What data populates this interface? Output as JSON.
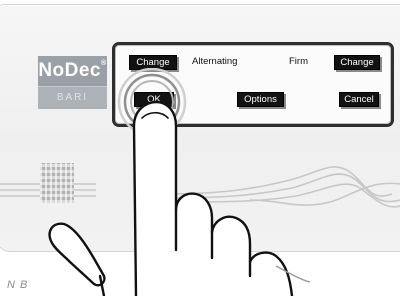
{
  "device": {
    "brand_name": "NoDec",
    "brand_trademark": "®",
    "model_name": "BARI"
  },
  "screen": {
    "change_left_label": "Change",
    "mode_left_label": "Alternating",
    "mode_right_label": "Firm",
    "change_right_label": "Change",
    "ok_label": "OK",
    "options_label": "Options",
    "cancel_label": "Cancel"
  },
  "caption": "N B",
  "colors": {
    "brand_panel": "#9aa0a5",
    "screen_border": "#2f2f2f",
    "lcd_button": "#121212",
    "ripple": "#c9c9c9"
  }
}
